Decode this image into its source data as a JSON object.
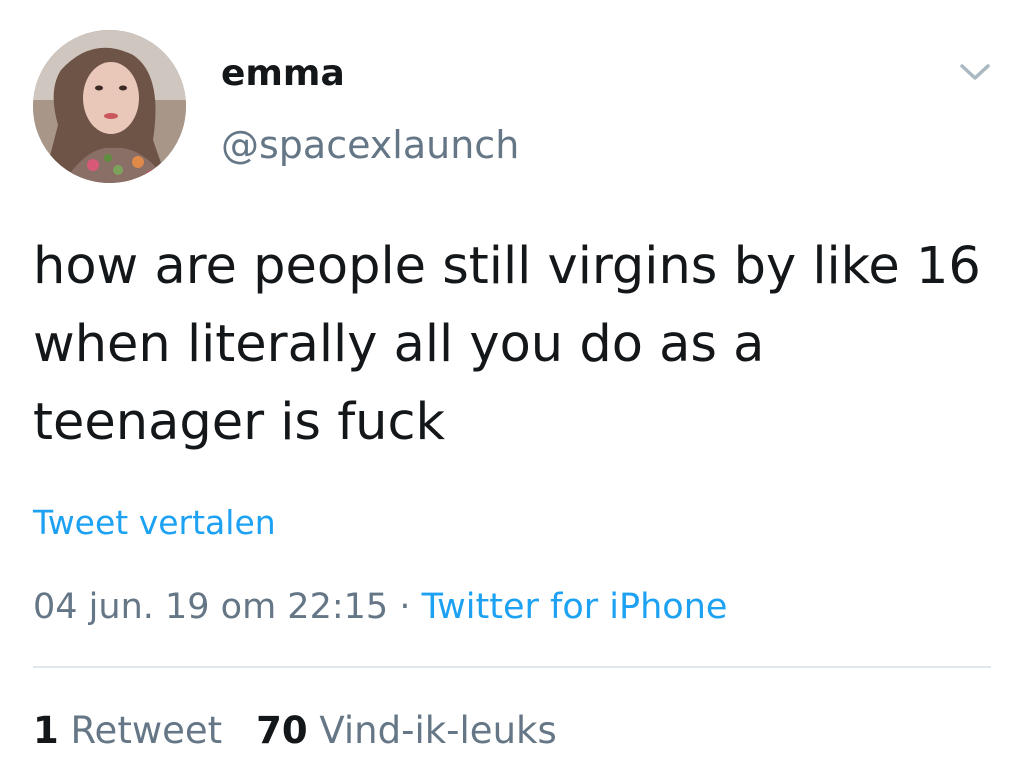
{
  "user": {
    "display_name": "emma",
    "handle": "@spacexlaunch",
    "avatar_icon": "user-avatar-photo"
  },
  "tweet": {
    "text": "how are people still virgins by like 16 when literally all you do as a teenager is fuck",
    "translate_label": "Tweet vertalen",
    "timestamp": "04 jun. 19 om 22:15",
    "separator": "·",
    "source": "Twitter for iPhone"
  },
  "stats": {
    "retweets_count": "1",
    "retweets_label": "Retweet",
    "likes_count": "70",
    "likes_label": "Vind-ik-leuks"
  },
  "colors": {
    "link": "#1da1f2",
    "secondary_text": "#657786",
    "primary_text": "#14171a",
    "divider": "#e1e8ed"
  },
  "icons": {
    "menu": "chevron-down-icon"
  }
}
